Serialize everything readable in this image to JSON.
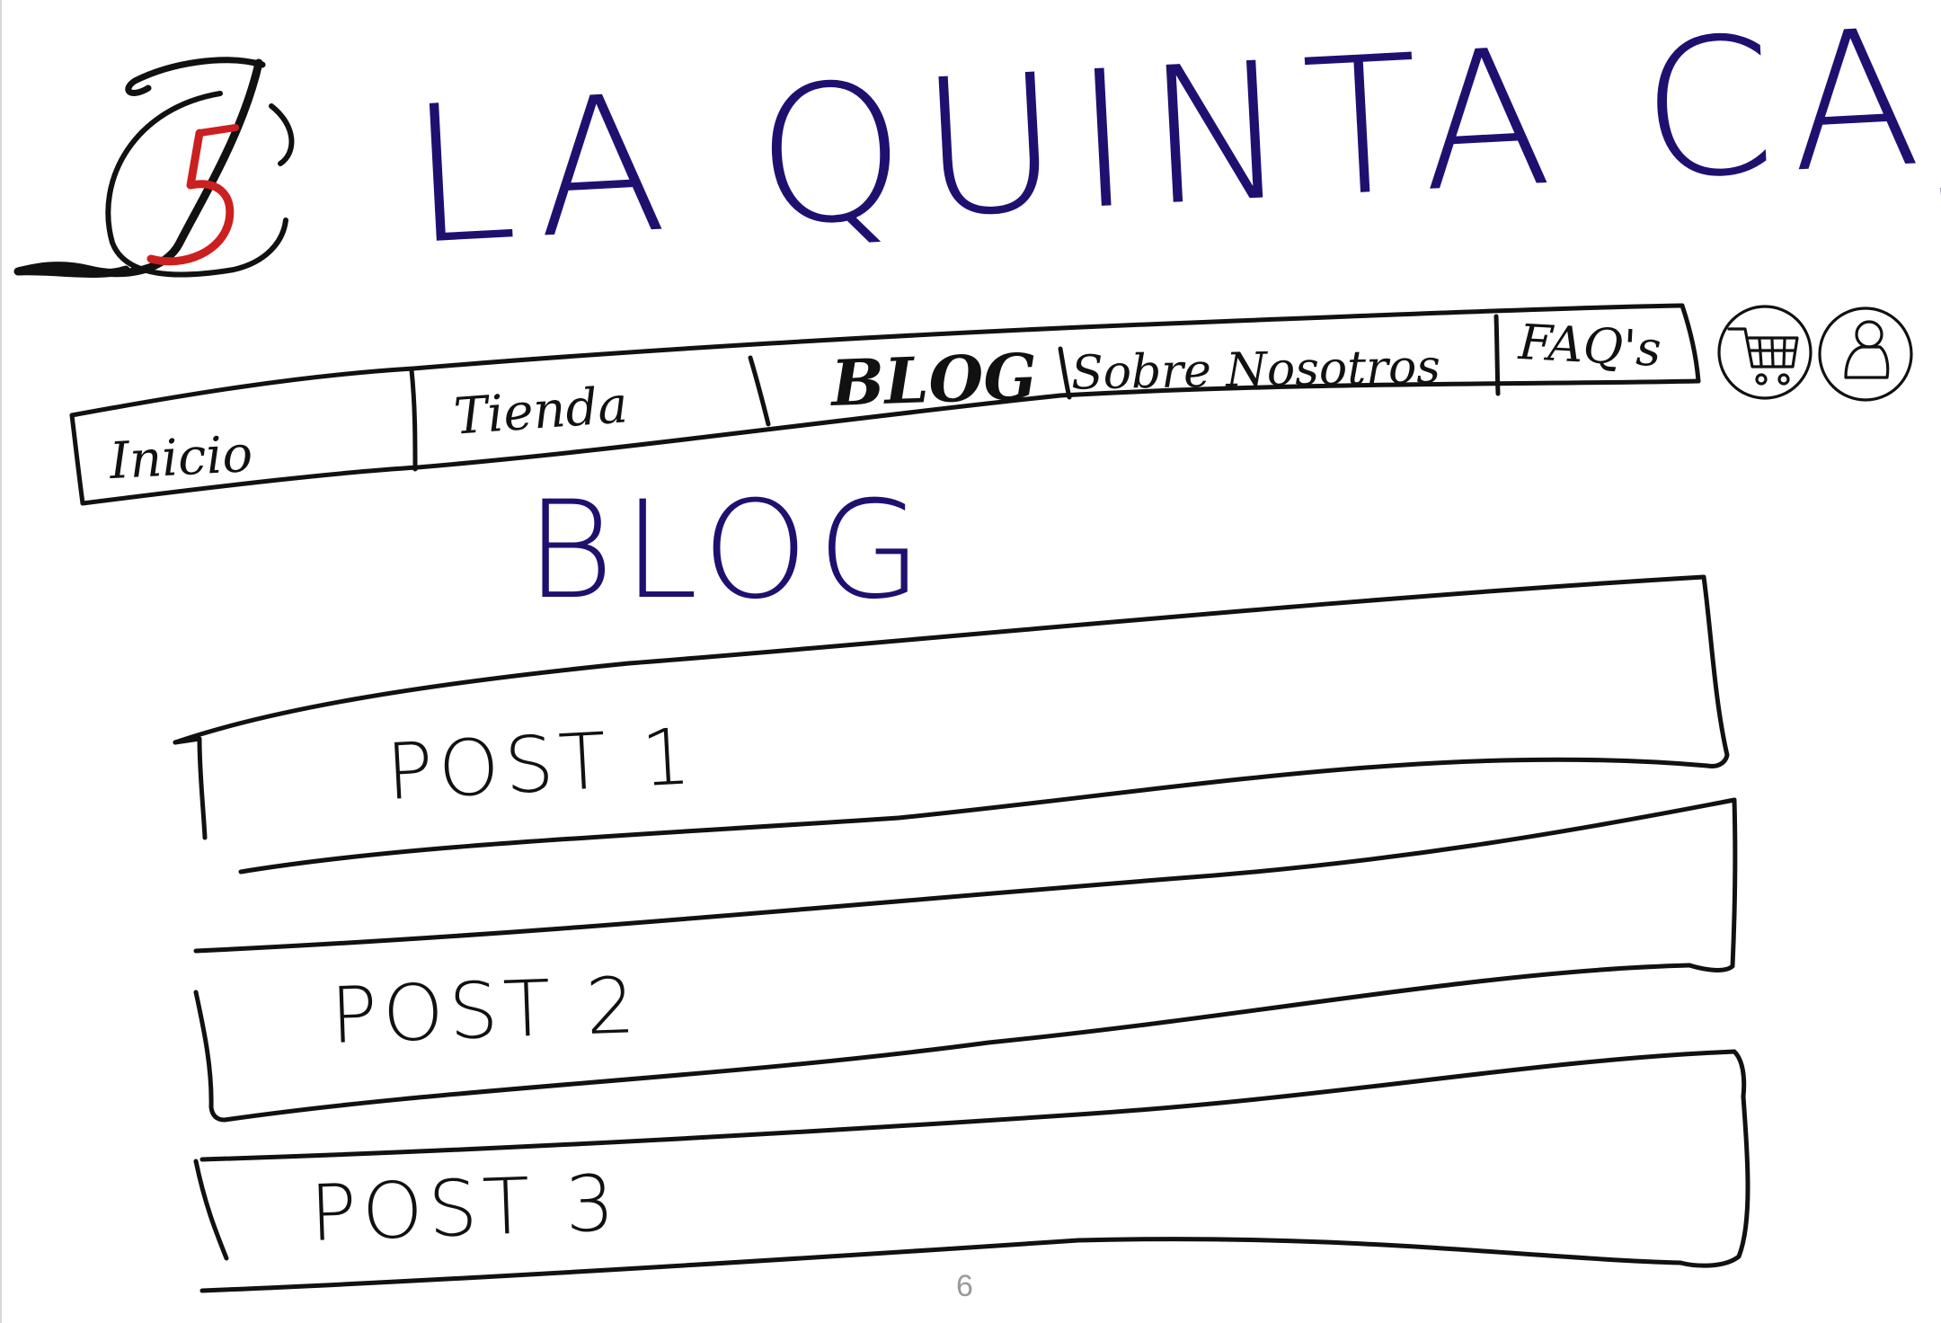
{
  "header": {
    "title": "LA QUINTA CAJA",
    "logo": {
      "name": "jc5-monogram-logo",
      "colors": {
        "primary": "#111111",
        "accent": "#cc1f1f"
      }
    }
  },
  "nav": {
    "items": [
      {
        "label": "Inicio"
      },
      {
        "label": "Tienda"
      },
      {
        "label": "BLOG"
      },
      {
        "label": "Sobre Nosotros"
      },
      {
        "label": "FAQ's"
      }
    ],
    "icons": [
      "cart-icon",
      "user-icon"
    ]
  },
  "main": {
    "heading": "BLOG",
    "posts": [
      {
        "title": "POST 1"
      },
      {
        "title": "POST 2"
      },
      {
        "title": "POST 3"
      }
    ]
  },
  "footer": {
    "page_number": "6"
  },
  "colors": {
    "ink": "#111111",
    "title_ink": "#1f1070",
    "page_number": "#9a9a9a"
  }
}
